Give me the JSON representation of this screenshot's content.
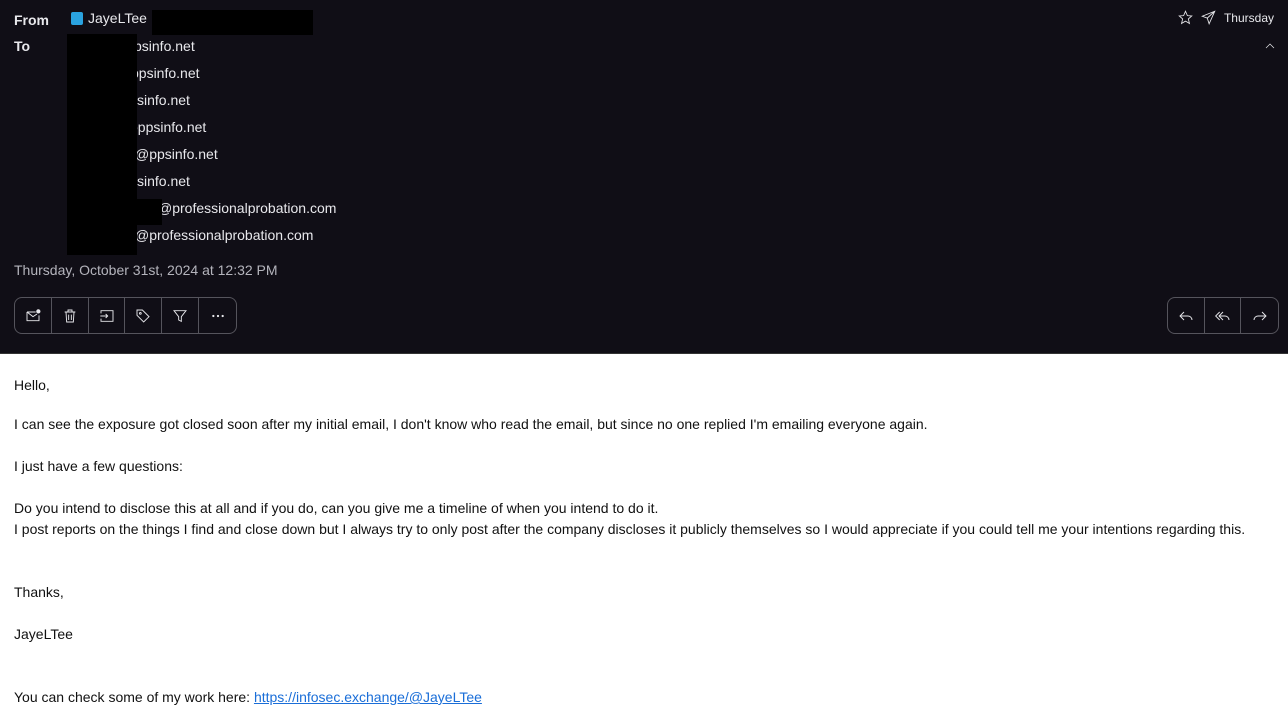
{
  "header": {
    "from_label": "From",
    "to_label": "To",
    "sender": "JayeLTee",
    "recipients": [
      "psinfo.net",
      "ppsinfo.net",
      "sinfo.net",
      "oppsinfo.net",
      "@ppsinfo.net",
      "sinfo.net",
      "@professionalprobation.com",
      "@professionalprobation.com"
    ],
    "date_short": "Thursday",
    "date_full": "Thursday, October 31st, 2024 at 12:32 PM"
  },
  "toolbar": [
    "mark-unread",
    "delete",
    "move",
    "tag",
    "filter",
    "more"
  ],
  "reply_toolbar": [
    "reply",
    "reply-all",
    "forward"
  ],
  "body": {
    "greeting": "Hello,",
    "p1": "I can see the exposure got closed soon after my initial email, I don't know who read the email, but since no one replied I'm emailing everyone again.",
    "p2": "I just have a few questions:",
    "p3": "Do you intend to disclose this at all and if you do, can you give me a timeline of when you intend to do it.",
    "p4": "I post reports on the things I find and close down but I always try to only post after the company discloses it publicly themselves so I would appreciate if you could tell me your intentions regarding this.",
    "thanks": "Thanks,",
    "signature": "JayeLTee",
    "link_prefix": "You can check some of my work here: ",
    "link": "https://infosec.exchange/@JayeLTee"
  }
}
